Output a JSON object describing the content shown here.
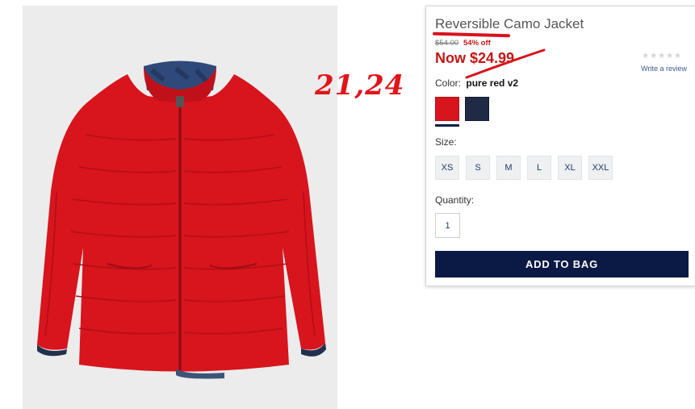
{
  "product": {
    "image_alt": "Red puffer jacket with navy camo lining",
    "title": "Reversible Camo Jacket",
    "original_price": "$54.00",
    "discount": "54% off",
    "sale_price": "Now $24.99",
    "rating_stars": "★★★★★",
    "write_review": "Write a review"
  },
  "annotation": {
    "handwritten_text": "21,24",
    "color": "#e0151b"
  },
  "color_selector": {
    "label": "Color:",
    "selected_value": "pure red v2",
    "swatches": [
      {
        "name": "pure red v2",
        "hex": "#d8141c",
        "selected": true
      },
      {
        "name": "navy",
        "hex": "#1f2a44",
        "selected": false
      }
    ]
  },
  "size_selector": {
    "label": "Size:",
    "options": [
      "XS",
      "S",
      "M",
      "L",
      "XL",
      "XXL"
    ]
  },
  "quantity": {
    "label": "Quantity:",
    "value": "1"
  },
  "cta": {
    "add_to_bag": "ADD TO BAG",
    "bg_color": "#0b1a45"
  },
  "colors": {
    "sale_red": "#c41616",
    "link_blue": "#3a5a8a"
  }
}
